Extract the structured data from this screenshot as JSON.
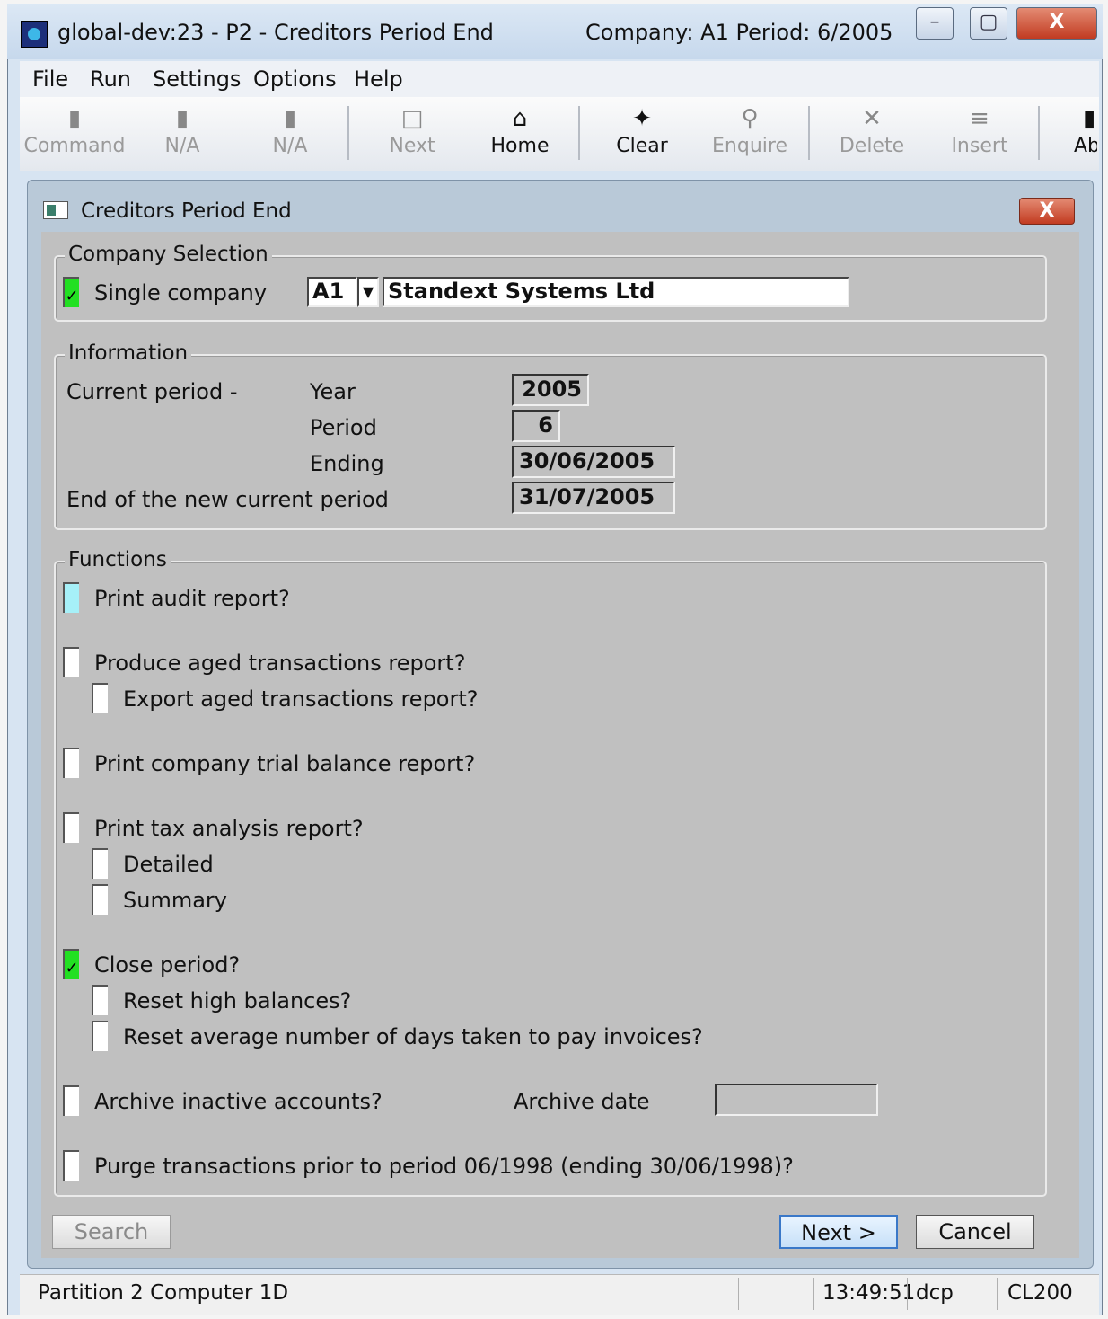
{
  "window": {
    "title": "global-dev:23 - P2 - Creditors Period End",
    "context": "Company: A1  Period:  6/2005",
    "minimize": "–",
    "maximize": "▢",
    "close": "X"
  },
  "menu": [
    {
      "label": "File"
    },
    {
      "label": "Run"
    },
    {
      "label": "Settings"
    },
    {
      "label": "Options"
    },
    {
      "label": "Help"
    }
  ],
  "toolbar": [
    {
      "label": "Command",
      "icon": "f1-icon",
      "enabled": false
    },
    {
      "label": "N/A",
      "icon": "f2-icon",
      "enabled": false
    },
    {
      "label": "N/A",
      "icon": "f3-icon",
      "enabled": false
    },
    {
      "label": "Next",
      "icon": "page-icon",
      "enabled": false
    },
    {
      "label": "Home",
      "icon": "home-icon",
      "enabled": true
    },
    {
      "label": "Clear",
      "icon": "clear-icon",
      "enabled": true
    },
    {
      "label": "Enquire",
      "icon": "magnifier-icon",
      "enabled": false
    },
    {
      "label": "Delete",
      "icon": "x-icon",
      "enabled": false
    },
    {
      "label": "Insert",
      "icon": "insert-icon",
      "enabled": false
    },
    {
      "label": "Ab",
      "icon": "abandon-icon",
      "enabled": true
    }
  ],
  "dialog": {
    "title": "Creditors Period End",
    "close": "X"
  },
  "company_selection": {
    "legend": "Company Selection",
    "single_company_label": "Single company",
    "single_company_checked": true,
    "company_code": "A1",
    "company_name": "Standext Systems Ltd"
  },
  "information": {
    "legend": "Information",
    "current_period_label": "Current period -",
    "year_label": "Year",
    "year": "2005",
    "period_label": "Period",
    "period": "6",
    "ending_label": "Ending",
    "ending": "30/06/2005",
    "new_period_label": "End of the new current period",
    "new_period_end": "31/07/2005"
  },
  "functions": {
    "legend": "Functions",
    "print_audit": "Print audit report?",
    "aged": "Produce aged transactions report?",
    "export_aged": "Export aged transactions report?",
    "trial_balance": "Print company trial balance report?",
    "tax_analysis": "Print tax analysis report?",
    "detailed": "Detailed",
    "summary": "Summary",
    "close_period": "Close period?",
    "close_period_checked": true,
    "reset_high": "Reset high balances?",
    "reset_avg": "Reset average number of days taken to pay invoices?",
    "archive": "Archive inactive accounts?",
    "archive_date_label": "Archive date",
    "archive_date": "",
    "purge": "Purge transactions prior to period 06/1998 (ending 30/06/1998)?"
  },
  "buttons": {
    "search": "Search",
    "next": "Next >",
    "cancel": "Cancel"
  },
  "status": {
    "left": "Partition 2 Computer 1D",
    "time": "13:49:51",
    "user": "dcp",
    "program": "CL200"
  }
}
